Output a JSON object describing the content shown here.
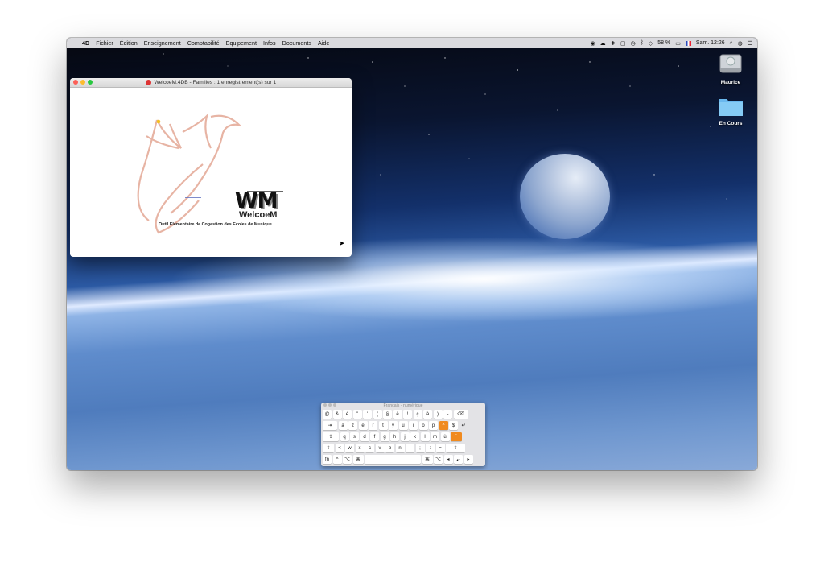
{
  "menubar": {
    "app": "4D",
    "items": [
      "Fichier",
      "Édition",
      "Enseignement",
      "Comptabilité",
      "Equipement",
      "Infos",
      "Documents",
      "Aide"
    ],
    "battery": "58 %",
    "clock": "Sam. 12:26"
  },
  "desktop": {
    "icons": [
      {
        "label": "Maurice",
        "icon": "hard-drive-icon"
      },
      {
        "label": "En Cours",
        "icon": "folder-icon"
      }
    ]
  },
  "window": {
    "title": "WelcoeM.4DB - Familles : 1 enregistrement(s) sur 1",
    "logo_text": "WM",
    "brand": "WelcoeM",
    "tagline": "Outil Elémentaire de Cogestion des Ecoles de Musique"
  },
  "keyboard": {
    "title": "Français - numérique",
    "rows": [
      [
        "@",
        "&",
        "é",
        "\"",
        "'",
        "(",
        "§",
        "è",
        "!",
        "ç",
        "à",
        ")",
        "-",
        "⌫"
      ],
      [
        "⇥",
        "a",
        "z",
        "e",
        "r",
        "t",
        "y",
        "u",
        "i",
        "o",
        "p",
        "^",
        "$",
        "↵"
      ],
      [
        "⇪",
        "q",
        "s",
        "d",
        "f",
        "g",
        "h",
        "j",
        "k",
        "l",
        "m",
        "ù",
        "`"
      ],
      [
        "⇧",
        "<",
        "w",
        "x",
        "c",
        "v",
        "b",
        "n",
        ",",
        ";",
        ":",
        "=",
        "⇧"
      ],
      [
        "fn",
        "^",
        "⌥",
        "⌘",
        " ",
        "⌘",
        "⌥",
        "◂",
        "▴▾",
        "▸"
      ]
    ]
  },
  "colors": {
    "accent": "#f08a1e",
    "wm_black": "#111111"
  }
}
